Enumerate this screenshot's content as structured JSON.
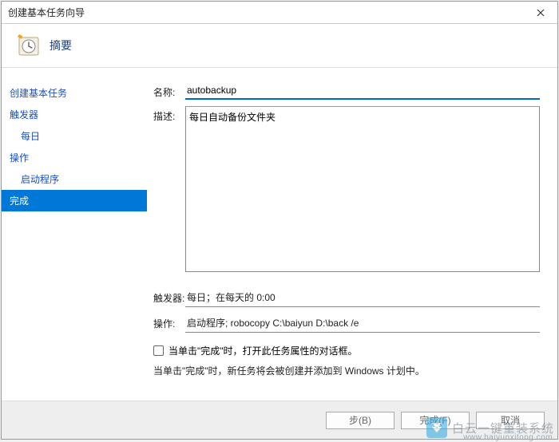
{
  "window": {
    "title": "创建基本任务向导"
  },
  "header": {
    "title": "摘要"
  },
  "sidebar": {
    "items": [
      {
        "label": "创建基本任务",
        "sub": false,
        "active": false
      },
      {
        "label": "触发器",
        "sub": false,
        "active": false
      },
      {
        "label": "每日",
        "sub": true,
        "active": false
      },
      {
        "label": "操作",
        "sub": false,
        "active": false
      },
      {
        "label": "启动程序",
        "sub": true,
        "active": false
      },
      {
        "label": "完成",
        "sub": false,
        "active": true
      }
    ]
  },
  "fields": {
    "name_label": "名称:",
    "name_value": "autobackup",
    "desc_label": "描述:",
    "desc_value": "每日自动备份文件夹",
    "trigger_label": "触发器:",
    "trigger_value": "每日；在每天的 0:00",
    "action_label": "操作:",
    "action_value": "启动程序; robocopy C:\\baiyun D:\\back /e"
  },
  "checkbox": {
    "label": "当单击\"完成\"时，打开此任务属性的对话框。"
  },
  "hint": "当单击\"完成\"时，新任务将会被创建并添加到 Windows 计划中。",
  "footer": {
    "back": "步(B)",
    "finish": "完成(F)",
    "cancel": "取消"
  },
  "watermark": {
    "brand": "白云一键重装系统",
    "url": "www.baiyunxitong.com"
  }
}
